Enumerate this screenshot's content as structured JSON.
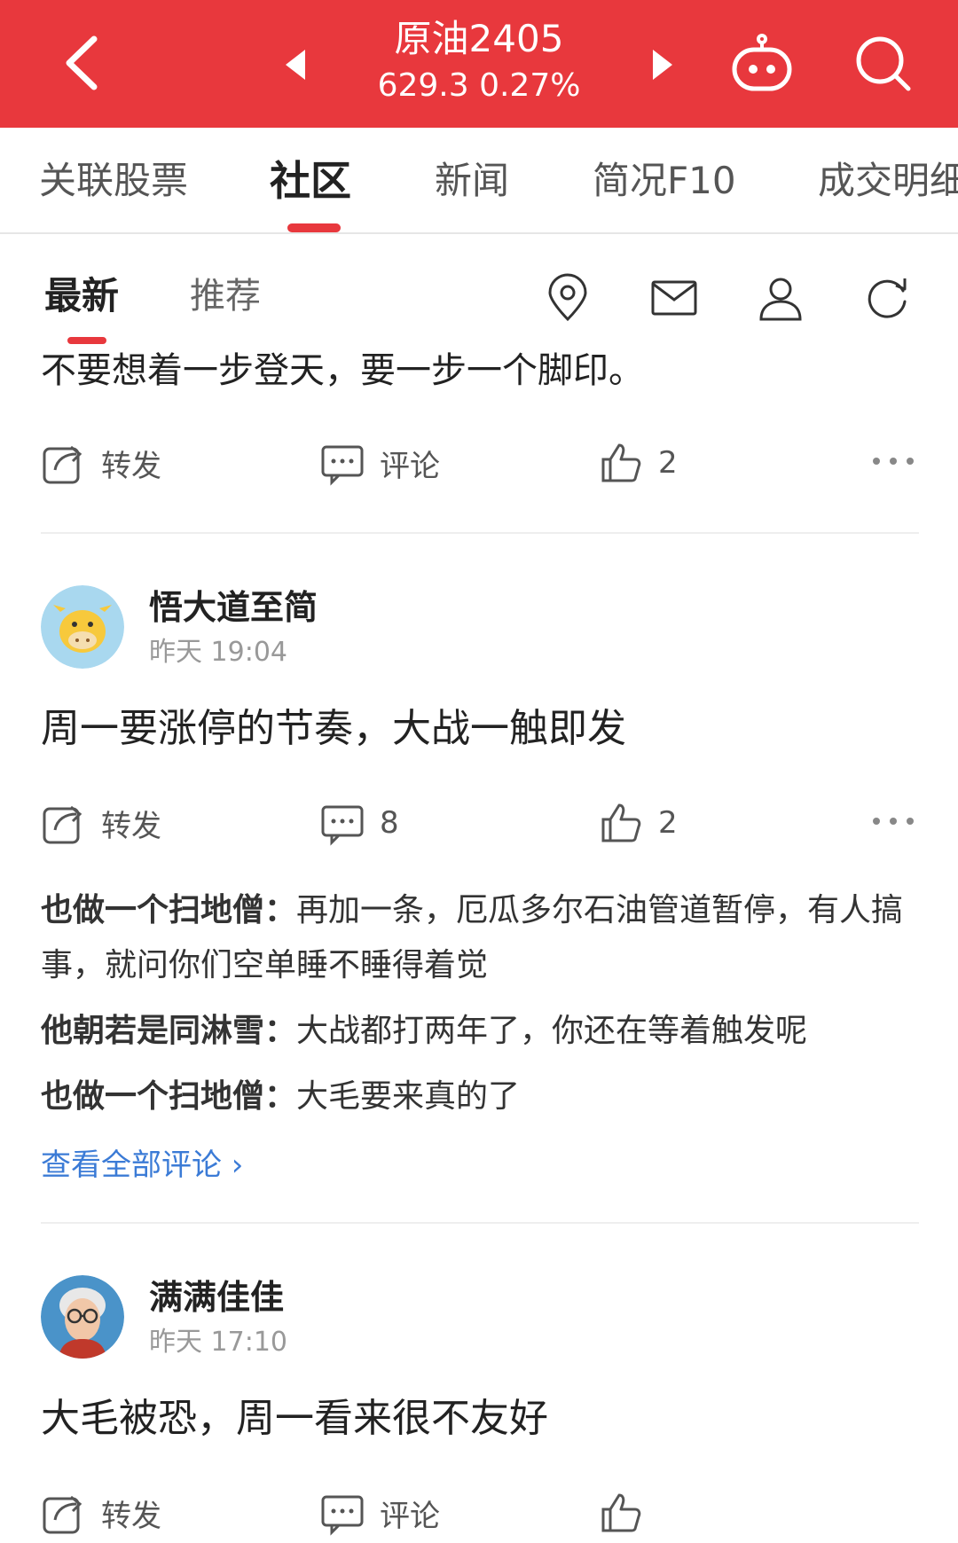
{
  "header": {
    "title": "原油2405",
    "quote": "629.3 0.27%",
    "bg_color": "#e8383d"
  },
  "tabs": [
    {
      "label": "关联股票"
    },
    {
      "label": "社区"
    },
    {
      "label": "新闻"
    },
    {
      "label": "简况F10"
    },
    {
      "label": "成交明细"
    }
  ],
  "subtabs": {
    "latest": "最新",
    "recommend": "推荐"
  },
  "feed": {
    "truncated_text": "不要想着一步登天，要一步一个脚印。",
    "post0_actions": {
      "share": "转发",
      "comment": "评论",
      "likes": "2"
    },
    "posts": [
      {
        "author": "悟大道至简",
        "time": "昨天 19:04",
        "text": "周一要涨停的节奏，大战一触即发",
        "share": "转发",
        "comments": "8",
        "likes": "2",
        "replies": [
          {
            "who": "也做一个扫地僧：",
            "text": "再加一条，厄瓜多尔石油管道暂停，有人搞事，就问你们空单睡不睡得着觉"
          },
          {
            "who": "他朝若是同淋雪：",
            "text": "大战都打两年了，你还在等着触发呢"
          },
          {
            "who": "也做一个扫地僧：",
            "text": "大毛要来真的了"
          }
        ],
        "view_all": "查看全部评论 ›"
      },
      {
        "author": "满满佳佳",
        "time": "昨天 17:10",
        "text": "大毛被恐，周一看来很不友好",
        "share": "转发",
        "comment": "评论"
      }
    ]
  }
}
